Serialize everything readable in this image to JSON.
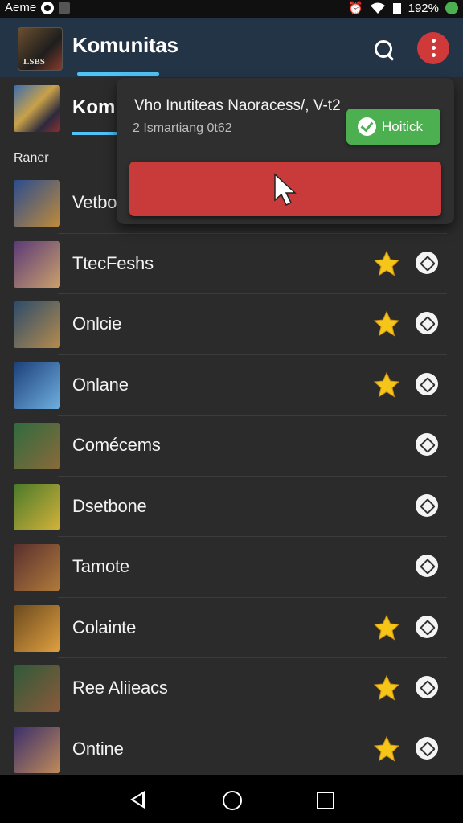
{
  "status_bar": {
    "carrier": "Aeme",
    "battery": "192%"
  },
  "app_bar": {
    "title": "Komunitas",
    "avatar_text": "LSBS"
  },
  "sub_header": {
    "title": "Kom",
    "section_label": "Raner"
  },
  "popup": {
    "title": "Vho Inutiteas Naoracess/, V-t2",
    "subtitle": "2 Ismartiang 0t62",
    "green_button_label": "Hoitick"
  },
  "list": {
    "items": [
      {
        "label": "Vetboc",
        "starred": false,
        "thumb_colors": [
          "#2a4d8f",
          "#c08a3a"
        ]
      },
      {
        "label": "TtecFeshs",
        "starred": true,
        "thumb_colors": [
          "#5b3a78",
          "#caa06b"
        ]
      },
      {
        "label": "Onlcie",
        "starred": true,
        "thumb_colors": [
          "#2c4c6b",
          "#b58b4d"
        ]
      },
      {
        "label": "Onlane",
        "starred": true,
        "thumb_colors": [
          "#1d3f7a",
          "#6fb0e0"
        ]
      },
      {
        "label": "Comécems",
        "starred": false,
        "thumb_colors": [
          "#2f6b3f",
          "#8a6a3a"
        ]
      },
      {
        "label": "Dsetbone",
        "starred": false,
        "thumb_colors": [
          "#4a7a2a",
          "#d4b23a"
        ]
      },
      {
        "label": "Tamote",
        "starred": false,
        "thumb_colors": [
          "#5a2f2f",
          "#b07a3a"
        ]
      },
      {
        "label": "Colainte",
        "starred": true,
        "thumb_colors": [
          "#6b4a1f",
          "#e0a040"
        ]
      },
      {
        "label": "Ree Aliieacs",
        "starred": true,
        "thumb_colors": [
          "#2f5a3a",
          "#8a5a3a"
        ]
      },
      {
        "label": "Ontine",
        "starred": true,
        "thumb_colors": [
          "#3a2f6b",
          "#c08a5a"
        ]
      }
    ]
  },
  "colors": {
    "app_bar_bg": "#243447",
    "accent": "#4fc3f7",
    "menu_button": "#d0393a",
    "confirm_green": "#4caf50",
    "action_red": "#c93a3a",
    "star": "#f5c518"
  },
  "icons": {
    "search": "search-icon",
    "menu": "more-vertical-icon",
    "check": "check-icon",
    "cursor": "pointer-cursor-icon",
    "star": "star-icon",
    "row_action": "edit-icon"
  }
}
